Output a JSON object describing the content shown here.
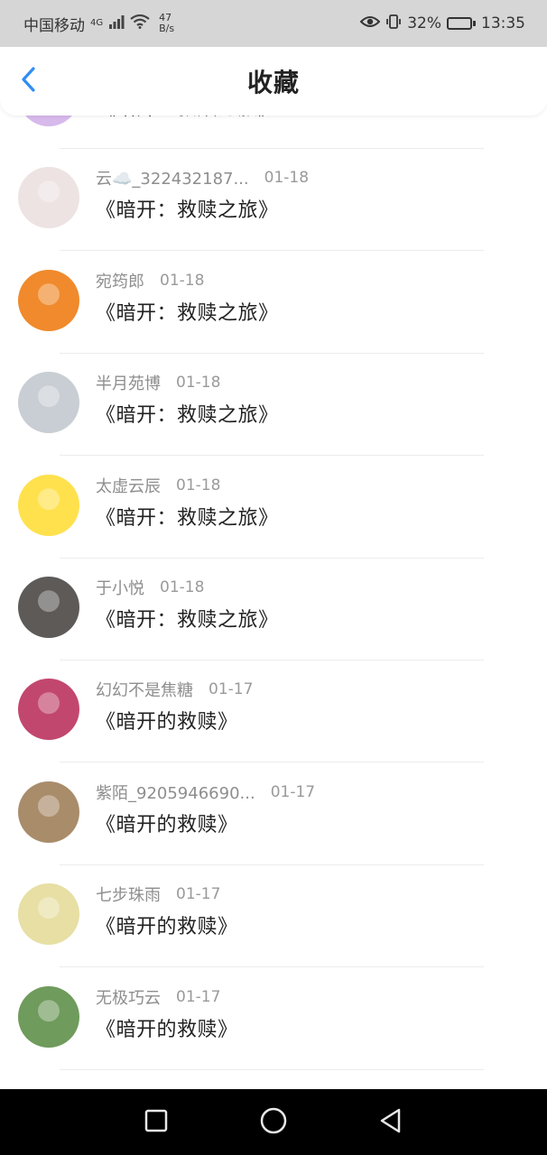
{
  "status_bar": {
    "carrier": "中国移动",
    "network": "4G",
    "speed_value": "47",
    "speed_unit": "B/s",
    "battery": "32%",
    "battery_level": 0.32,
    "time": "13:35"
  },
  "header": {
    "title": "收藏"
  },
  "favorites": [
    {
      "name": "",
      "date": "",
      "book": "《暗开：救赎之旅》",
      "avatar_color": "#d7b9ec"
    },
    {
      "name": "云☁️_322432187...",
      "date": "01-18",
      "book": "《暗开：救赎之旅》",
      "avatar_color": "#ede3e2"
    },
    {
      "name": "宛筠郎",
      "date": "01-18",
      "book": "《暗开：救赎之旅》",
      "avatar_color": "#f08a2c"
    },
    {
      "name": "半月苑博",
      "date": "01-18",
      "book": "《暗开：救赎之旅》",
      "avatar_color": "#c9ced4"
    },
    {
      "name": "太虚云辰",
      "date": "01-18",
      "book": "《暗开：救赎之旅》",
      "avatar_color": "#ffe14d"
    },
    {
      "name": "于小悦",
      "date": "01-18",
      "book": "《暗开：救赎之旅》",
      "avatar_color": "#5d5a58"
    },
    {
      "name": "幻幻不是焦糖",
      "date": "01-17",
      "book": "《暗开的救赎》",
      "avatar_color": "#c2476e"
    },
    {
      "name": "紫陌_9205946690...",
      "date": "01-17",
      "book": "《暗开的救赎》",
      "avatar_color": "#a98c6a"
    },
    {
      "name": "七步珠雨",
      "date": "01-17",
      "book": "《暗开的救赎》",
      "avatar_color": "#e7dfa4"
    },
    {
      "name": "无极巧云",
      "date": "01-17",
      "book": "《暗开的救赎》",
      "avatar_color": "#6f9b5c"
    }
  ],
  "colors": {
    "accent": "#2f8ef5",
    "status_bg": "#d6d6d6",
    "nav_bg": "#000000"
  },
  "icons": {
    "back": "chevron-left-icon",
    "eye": "eye-icon",
    "vibrate": "vibrate-icon",
    "wifi": "wifi-icon",
    "signal": "signal-icon",
    "nav_recent": "square-icon",
    "nav_home": "circle-icon",
    "nav_back": "triangle-icon"
  }
}
